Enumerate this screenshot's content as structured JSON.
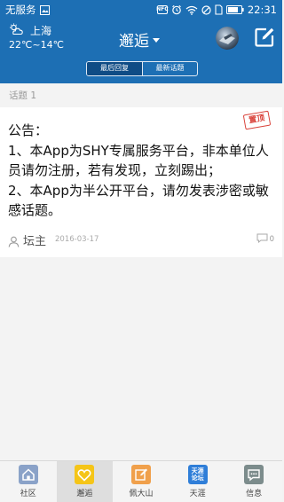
{
  "status_bar": {
    "carrier": "无服务",
    "nfc_label": "NFC",
    "time": "22:31"
  },
  "header": {
    "weather": {
      "city": "上海",
      "temperature": "22℃~14℃",
      "icon": "partly-cloudy-icon"
    },
    "title": "邂逅",
    "tabs": [
      {
        "label": "最后回复",
        "active": true
      },
      {
        "label": "最新话题",
        "active": false
      }
    ]
  },
  "content": {
    "section_label": "话题 1",
    "post": {
      "pinned_label": "置顶",
      "title_line": "公告：",
      "lines": [
        "1、本App为SHY专属服务平台，非本单位人员请勿注册，若有发现，立刻踢出；",
        "2、本App为半公开平台，请勿发表涉密或敏感话题。"
      ],
      "author": "坛主",
      "date": "2016-03-17",
      "comments": "0"
    }
  },
  "bottom_nav": [
    {
      "label": "社区",
      "icon": "home-icon",
      "color": "#8aa2c8",
      "active": false
    },
    {
      "label": "邂逅",
      "icon": "heart-icon",
      "color": "#f5c518",
      "active": true
    },
    {
      "label": "佩大山",
      "icon": "edit-icon",
      "color": "#f0a04b",
      "active": false
    },
    {
      "label": "天涯",
      "icon": "tianya-forum-icon",
      "icon_text": [
        "天涯",
        "论坛"
      ],
      "color": "#2f7ed8",
      "active": false
    },
    {
      "label": "信息",
      "icon": "message-icon",
      "color": "#7c8c8c",
      "active": false
    }
  ],
  "colors": {
    "primary": "#1d6fb4",
    "stamp": "#d9433b"
  }
}
